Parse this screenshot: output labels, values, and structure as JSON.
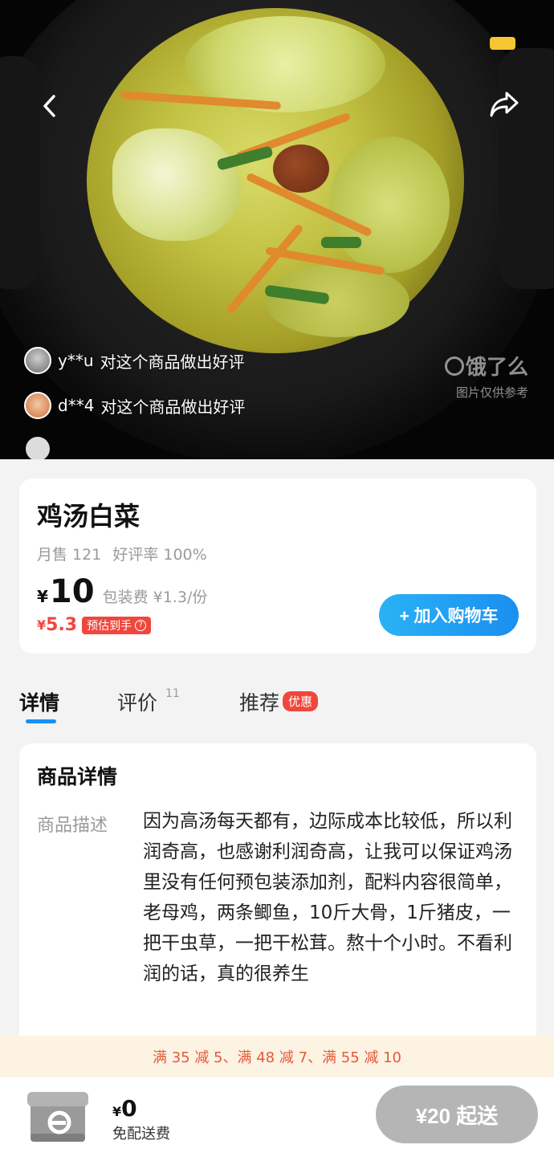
{
  "hero": {
    "back_icon": "chevron-left-icon",
    "share_icon": "share-icon",
    "reviews": [
      {
        "user": "y**u",
        "text": "对这个商品做出好评"
      },
      {
        "user": "d**4",
        "text": "对这个商品做出好评"
      }
    ],
    "watermark": {
      "brand": "饿了么",
      "note": "图片仅供参考"
    }
  },
  "product": {
    "name": "鸡汤白菜",
    "monthly_sales": "月售 121",
    "rating": "好评率 100%",
    "currency": "¥",
    "price": "10",
    "packaging_fee": "包装费 ¥1.3/份",
    "estimated_price": "5.3",
    "estimated_tag": "预估到手",
    "add_to_cart": "+ 加入购物车"
  },
  "tabs": [
    {
      "label": "详情",
      "active": true
    },
    {
      "label": "评价",
      "count": "11"
    },
    {
      "label": "推荐",
      "badge": "优惠"
    }
  ],
  "detail": {
    "title": "商品详情",
    "label": "商品描述",
    "description": "因为高汤每天都有，边际成本比较低，所以利润奇高，也感谢利润奇高，让我可以保证鸡汤里没有任何预包装添加剂，配料内容很简单，老母鸡，两条鲫鱼，10斤大骨，1斤猪皮，一把干虫草，一把干松茸。熬十个小时。不看利润的话，真的很养生"
  },
  "promo": "满 35 减 5、满 48 减 7、满 55 减 10",
  "bottom": {
    "currency": "¥",
    "total": "0",
    "delivery": "免配送费",
    "min_order": "¥20 起送"
  },
  "colors": {
    "accent": "#1a8ff0",
    "discount": "#f0473d",
    "promo_bg": "#fdf3e3"
  }
}
